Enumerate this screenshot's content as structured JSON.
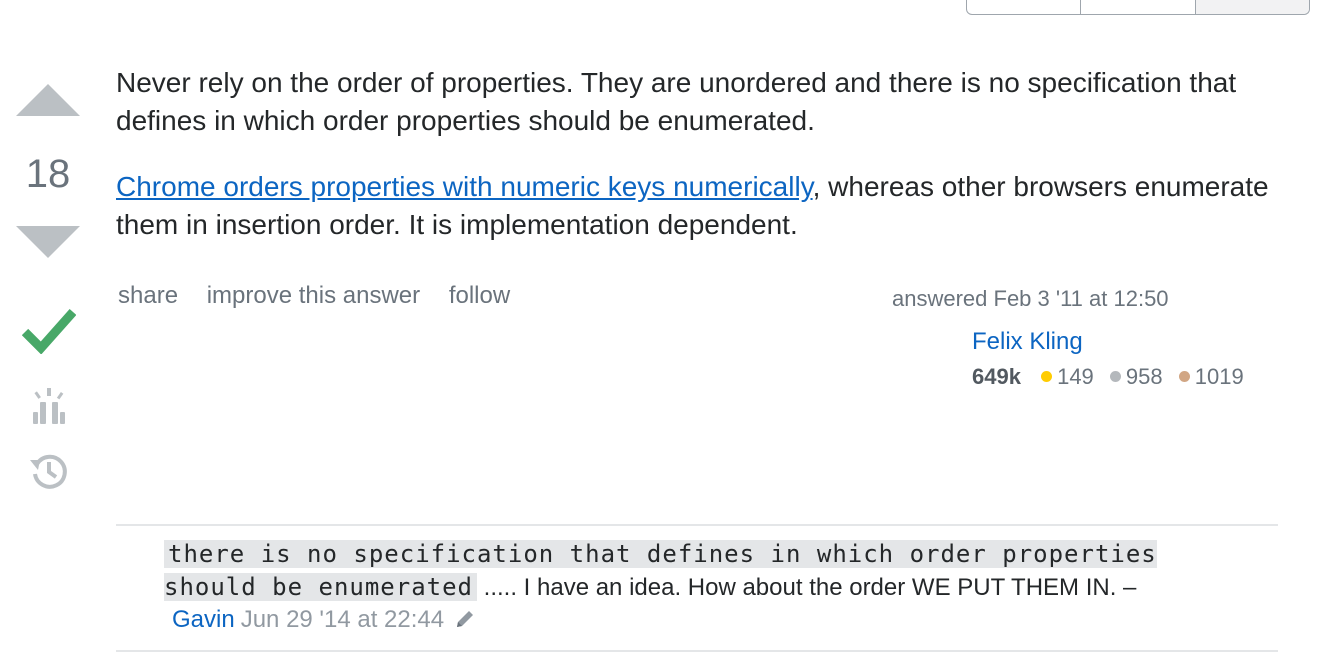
{
  "post": {
    "paragraph1": "Never rely on the order of properties. They are unordered and there is no specification that defines in which order properties should be enumerated.",
    "link_text": "Chrome orders properties with numeric keys numerically",
    "paragraph2_rest": ", whereas other browsers enumerate them in insertion order. It is implementation dependent."
  },
  "vote": {
    "score": "18"
  },
  "menu": {
    "share": "share",
    "improve": "improve this answer",
    "follow": "follow"
  },
  "user": {
    "action_time": "answered Feb 3 '11 at 12:50",
    "name": "Felix Kling",
    "reputation": "649k",
    "gold": "149",
    "silver": "958",
    "bronze": "1019",
    "colors": {
      "gold": "#ffcc01",
      "silver": "#b4b8bc",
      "bronze": "#d1a684"
    }
  },
  "comment": {
    "code": "there is no specification that defines in which order properties should be enumerated",
    "text": " ..... I have an idea. How about the order WE PUT THEM IN. –",
    "user": "Gavin",
    "date": "Jun 29 '14 at 22:44"
  },
  "icons": {
    "accepted": "accepted-checkmark-icon",
    "bounty": "bounty-award-icon",
    "history": "timeline-history-icon",
    "edit": "pencil-edit-icon"
  }
}
